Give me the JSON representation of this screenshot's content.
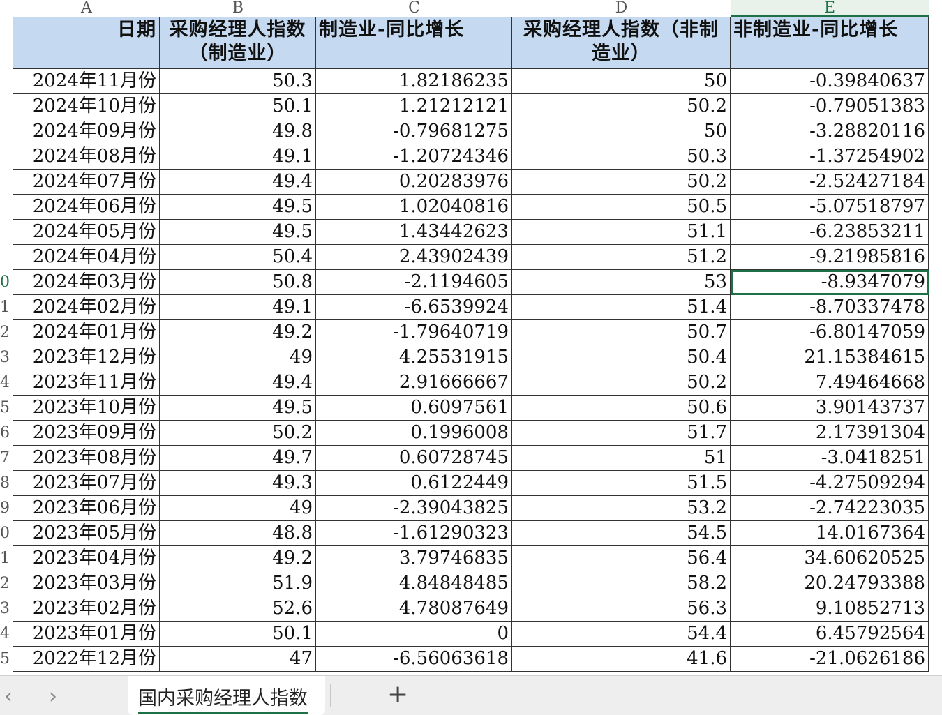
{
  "columns": [
    "A",
    "B",
    "C",
    "D",
    "E"
  ],
  "active_column": "E",
  "header": {
    "date": "日期",
    "pmi_mfg": "采购经理人指数（制造业）",
    "mfg_yoy": "制造业-同比增长",
    "pmi_nonmfg": "采购经理人指数（非制造业）",
    "nonmfg_yoy": "非制造业-同比增长"
  },
  "row_numbers": [
    "",
    "",
    "",
    "",
    "",
    "",
    "",
    "",
    "",
    "0",
    "1",
    "2",
    "3",
    "4",
    "5",
    "6",
    "7",
    "8",
    "9",
    "0",
    "1",
    "2",
    "3",
    "4",
    "5"
  ],
  "active_row_number": "0",
  "rows": [
    [
      "2024年11月份",
      "50.3",
      "1.82186235",
      "50",
      "-0.39840637"
    ],
    [
      "2024年10月份",
      "50.1",
      "1.21212121",
      "50.2",
      "-0.79051383"
    ],
    [
      "2024年09月份",
      "49.8",
      "-0.79681275",
      "50",
      "-3.28820116"
    ],
    [
      "2024年08月份",
      "49.1",
      "-1.20724346",
      "50.3",
      "-1.37254902"
    ],
    [
      "2024年07月份",
      "49.4",
      "0.20283976",
      "50.2",
      "-2.52427184"
    ],
    [
      "2024年06月份",
      "49.5",
      "1.02040816",
      "50.5",
      "-5.07518797"
    ],
    [
      "2024年05月份",
      "49.5",
      "1.43442623",
      "51.1",
      "-6.23853211"
    ],
    [
      "2024年04月份",
      "50.4",
      "2.43902439",
      "51.2",
      "-9.21985816"
    ],
    [
      "2024年03月份",
      "50.8",
      "-2.1194605",
      "53",
      "-8.9347079"
    ],
    [
      "2024年02月份",
      "49.1",
      "-6.6539924",
      "51.4",
      "-8.70337478"
    ],
    [
      "2024年01月份",
      "49.2",
      "-1.79640719",
      "50.7",
      "-6.80147059"
    ],
    [
      "2023年12月份",
      "49",
      "4.25531915",
      "50.4",
      "21.15384615"
    ],
    [
      "2023年11月份",
      "49.4",
      "2.91666667",
      "50.2",
      "7.49464668"
    ],
    [
      "2023年10月份",
      "49.5",
      "0.6097561",
      "50.6",
      "3.90143737"
    ],
    [
      "2023年09月份",
      "50.2",
      "0.1996008",
      "51.7",
      "2.17391304"
    ],
    [
      "2023年08月份",
      "49.7",
      "0.60728745",
      "51",
      "-3.0418251"
    ],
    [
      "2023年07月份",
      "49.3",
      "0.6122449",
      "51.5",
      "-4.27509294"
    ],
    [
      "2023年06月份",
      "49",
      "-2.39043825",
      "53.2",
      "-2.74223035"
    ],
    [
      "2023年05月份",
      "48.8",
      "-1.61290323",
      "54.5",
      "14.0167364"
    ],
    [
      "2023年04月份",
      "49.2",
      "3.79746835",
      "56.4",
      "34.60620525"
    ],
    [
      "2023年03月份",
      "51.9",
      "4.84848485",
      "58.2",
      "20.24793388"
    ],
    [
      "2023年02月份",
      "52.6",
      "4.78087649",
      "56.3",
      "9.10852713"
    ],
    [
      "2023年01月份",
      "50.1",
      "0",
      "54.4",
      "6.45792564"
    ],
    [
      "2022年12月份",
      "47",
      "-6.56063618",
      "41.6",
      "-21.0626186"
    ]
  ],
  "selected_cell": {
    "row": 8,
    "col": 4
  },
  "sheet_tabs": {
    "prev_icon": "‹",
    "next_icon": "›",
    "active_label": "国内采购经理人指数",
    "add_label": "+"
  },
  "colors": {
    "header_fill": "#c5d9f1",
    "accent": "#1e7145"
  }
}
